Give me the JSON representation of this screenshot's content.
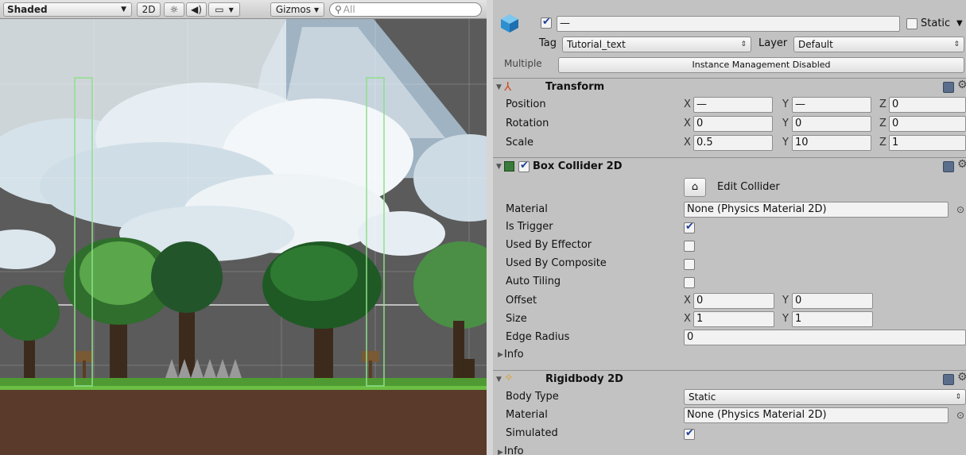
{
  "scene": {
    "toolbar": {
      "shading_mode": "Shaded",
      "btn_2d": "2D",
      "lighting_icon": "sun-icon",
      "audio_icon": "speaker-icon",
      "effects_icon": "image-icon",
      "gizmos_label": "Gizmos",
      "search_placeholder": "All"
    }
  },
  "inspector": {
    "header": {
      "active_checked": true,
      "name_value": "—",
      "static_label": "Static",
      "tag_label": "Tag",
      "tag_value": "Tutorial_text",
      "layer_label": "Layer",
      "layer_value": "Default",
      "multiple_label": "Multiple",
      "instance_management": "Instance Management Disabled"
    },
    "transform": {
      "title": "Transform",
      "rows": [
        {
          "label": "Position",
          "x": "—",
          "y": "—",
          "z": "0"
        },
        {
          "label": "Rotation",
          "x": "0",
          "y": "0",
          "z": "0"
        },
        {
          "label": "Scale",
          "x": "0.5",
          "y": "10",
          "z": "1"
        }
      ],
      "axis_x": "X",
      "axis_y": "Y",
      "axis_z": "Z"
    },
    "box_collider": {
      "title": "Box Collider 2D",
      "enabled": true,
      "edit_collider": "Edit Collider",
      "material_label": "Material",
      "material_value": "None (Physics Material 2D)",
      "is_trigger_label": "Is Trigger",
      "is_trigger": true,
      "used_by_effector_label": "Used By Effector",
      "used_by_effector": false,
      "used_by_composite_label": "Used By Composite",
      "used_by_composite": false,
      "auto_tiling_label": "Auto Tiling",
      "auto_tiling": false,
      "offset_label": "Offset",
      "offset_x": "0",
      "offset_y": "0",
      "size_label": "Size",
      "size_x": "1",
      "size_y": "1",
      "edge_radius_label": "Edge Radius",
      "edge_radius": "0",
      "info_label": "Info"
    },
    "rigidbody": {
      "title": "Rigidbody 2D",
      "body_type_label": "Body Type",
      "body_type_value": "Static",
      "material_label": "Material",
      "material_value": "None (Physics Material 2D)",
      "simulated_label": "Simulated",
      "simulated": true,
      "info_label": "Info"
    }
  }
}
